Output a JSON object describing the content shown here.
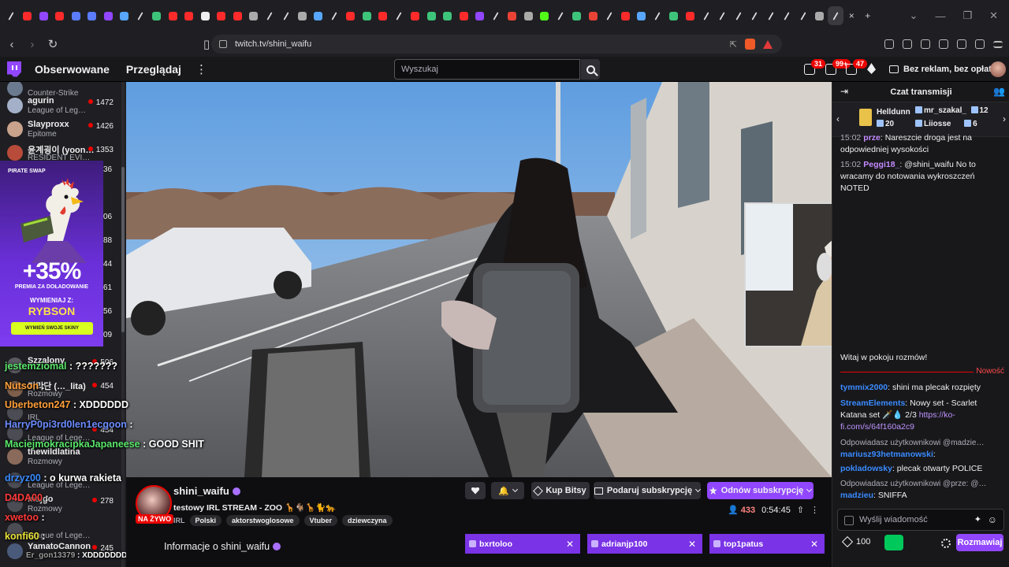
{
  "browser": {
    "url": "twitch.tv/shini_waifu",
    "tab_favicons": [
      "x",
      "yt",
      "tw",
      "yt",
      "dr",
      "dr",
      "tw",
      "bl",
      "x",
      "gr",
      "yt",
      "yt",
      "b",
      "yt",
      "yt",
      "ch",
      "x",
      "tk",
      "ch",
      "bl",
      "x",
      "yt",
      "gr",
      "yt",
      "x",
      "yt",
      "gr",
      "gr",
      "yt",
      "tw",
      "x",
      "go",
      "ch",
      "k",
      "x",
      "gr",
      "go",
      "x",
      "yt",
      "bl",
      "x",
      "gr",
      "yt",
      "x",
      "x",
      "x",
      "tk",
      "tk",
      "x",
      "x",
      "ch",
      "x"
    ],
    "active_tab_close": "×",
    "new_tab": "+"
  },
  "nav": {
    "following": "Obserwowane",
    "browse": "Przeglądaj",
    "search_placeholder": "Wyszukaj",
    "badge_notifications": "31",
    "badge_whispers": "99+",
    "badge_activity": "47",
    "no_ads": "Bez reklam, bez opłat"
  },
  "sidebar": {
    "items": [
      {
        "name": "",
        "game": "Counter-Strike",
        "viewers": "",
        "color": "#6b7a8f"
      },
      {
        "name": "agurin",
        "game": "League of Leg…",
        "viewers": "1472",
        "color": "#a4b0c8"
      },
      {
        "name": "Slayproxx",
        "game": "Epitome",
        "viewers": "1426",
        "color": "#c9a38c"
      },
      {
        "name": "윤계굉이 (yoon…",
        "game": "RESIDENT EVI…",
        "viewers": "1353",
        "color": "#b84b3a"
      },
      {
        "name": "Szzalony",
        "game": "",
        "viewers": "506",
        "color": "#5a5a62"
      },
      {
        "name": "기리단 (…_lita)",
        "game": "Rozmowy",
        "viewers": "454",
        "color": "#7d5f4b"
      },
      {
        "name": "",
        "game": "IRL",
        "viewers": "",
        "color": "#4c4c54"
      },
      {
        "name": "",
        "game": "League of Lege…",
        "viewers": "434",
        "color": "#4c4c54"
      },
      {
        "name": "thewildlatina",
        "game": "Rozmowy",
        "viewers": "",
        "color": "#8a6a5a"
      },
      {
        "name": "",
        "game": "League of Lege…",
        "viewers": "",
        "color": "#4c4c54"
      },
      {
        "name": "majgo",
        "game": "Rozmowy",
        "viewers": "278",
        "color": "#4c4c54"
      },
      {
        "name": "",
        "game": "League of Lege…",
        "viewers": "",
        "color": "#4c4c54"
      },
      {
        "name": "YamatoCannon",
        "game": "",
        "viewers": "245",
        "color": "#4a5a7a"
      }
    ],
    "partial_counts": [
      "36",
      "06",
      "88",
      "44",
      "61",
      "56",
      "09"
    ]
  },
  "promo": {
    "brand": "PIRATE SWAP",
    "percent": "+35%",
    "line1": "PREMIA ZA DOŁADOWANIE",
    "line2": "WYMIENIAJ Z:",
    "line3": "RYBSON",
    "cta": "WYMIEŃ SWOJE SKINY"
  },
  "overlay_chat": [
    {
      "user": "jestemziomal",
      "text": " : ???????",
      "color": "#5ae66b"
    },
    {
      "user": "Nutson",
      "text": " :",
      "color": "#ff9f3a"
    },
    {
      "user": "Uberbeton247",
      "text": " : XDDDDDD",
      "color": "#ff9f3a"
    },
    {
      "user": "HarryP0pi3rd0len1ecgoon",
      "text": " :",
      "color": "#6c8cff"
    },
    {
      "user": "MaciejmokracipkaJapaneese",
      "text": " : GOOD SHIT",
      "color": "#5ae66b"
    },
    {
      "user": "drzyz00",
      "text": " : o kurwa rakieta",
      "color": "#3a8bff"
    },
    {
      "user": "D4DA00",
      "text": " :",
      "color": "#ff3a3a"
    },
    {
      "user": "xwetoo",
      "text": " :",
      "color": "#ff3a3a"
    },
    {
      "user": "konfi60",
      "text": " :",
      "color": "#e8e23a"
    },
    {
      "user": "Er_gon13379",
      "text": " : XDDDDDDDD",
      "color": "#9a9a9a"
    }
  ],
  "stream": {
    "name": "shini_waifu",
    "title": "testowy IRL STREAM - ZOO 🦒🐐🦒🐈🐆",
    "live": "NA ŻYWO",
    "tags": [
      "IRL",
      "Polski",
      "aktorstwoglosowe",
      "Vtuber",
      "dziewczyna"
    ],
    "viewers": "433",
    "uptime": "0:54:45",
    "about": "Informacje o shini_waifu"
  },
  "actions": {
    "bits": "Kup Bitsy",
    "gift": "Podaruj subskrypcję",
    "renew": "Odnów subskrypcję"
  },
  "bottom_tabs": [
    {
      "label": "bxrtoloo"
    },
    {
      "label": "adrianjp100"
    },
    {
      "label": "top1patus"
    }
  ],
  "chat": {
    "title": "Czat transmisji",
    "gifters": [
      {
        "name": "Helldunn",
        "count": "20"
      },
      {
        "name": "mr_szakal_",
        "count": "12"
      },
      {
        "name": "Liiosse",
        "count": "6"
      }
    ],
    "messages_top": [
      {
        "time": "15:02",
        "user": "prze",
        "text": ": Nareszcie droga jest na odpowiedniej wysokości",
        "color": "#c48bff"
      },
      {
        "time": "15:02",
        "user": "Peggi18_",
        "text": ": @shini_waifu No to wracamy do notowania wykroszczeń NOTED",
        "color": "#c48bff"
      }
    ],
    "welcome": "Witaj w pokoju rozmów!",
    "new_label": "Nowość",
    "messages": [
      {
        "user": "tymmix2000",
        "text": ": shini ma plecak rozpięty",
        "color": "#3a8bff"
      },
      {
        "user": "StreamElements",
        "text": ": Nowy set - Scarlet Katana set 🗡️💧 2/3 ",
        "link": "https://ko-fi.com/s/64f160a2c9",
        "color": "#3a8bff"
      },
      {
        "reply": "Odpowiadasz użytkownikowi @madzie…",
        "user": "mariusz93hetmanowski",
        "text": ":",
        "color": "#3a8bff"
      },
      {
        "user": "pokladowsky",
        "text": ": plecak otwarty POLICE",
        "color": "#3a8bff"
      },
      {
        "reply": "Odpowiadasz użytkownikowi @prze: @…",
        "user": "madzieu",
        "text": ": SNIFFA",
        "color": "#3a8bff"
      }
    ],
    "input_placeholder": "Wyślij wiadomość",
    "points": "100",
    "send": "Rozmawiaj"
  }
}
